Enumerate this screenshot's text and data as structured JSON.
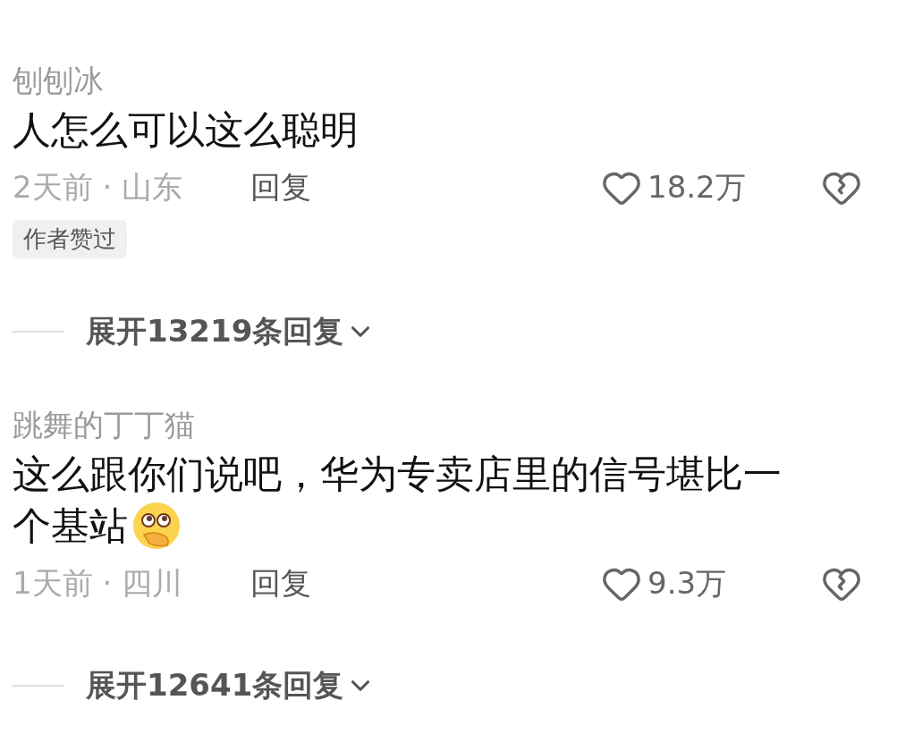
{
  "comments": [
    {
      "user": "刨刨冰",
      "text_lines": [
        "人怎么可以这么聪明"
      ],
      "trailing_emoji": false,
      "time": "2天前 · 山东",
      "reply": "回复",
      "likes": "18.2万",
      "badge": "作者赞过",
      "expand": "展开13219条回复"
    },
    {
      "user": "跳舞的丁丁猫",
      "text_lines": [
        "这么跟你们说吧，华为专卖店里的信号堪比一",
        "个基站"
      ],
      "trailing_emoji": true,
      "time": "1天前 · 四川",
      "reply": "回复",
      "likes": "9.3万",
      "expand": "展开12641条回复"
    }
  ]
}
